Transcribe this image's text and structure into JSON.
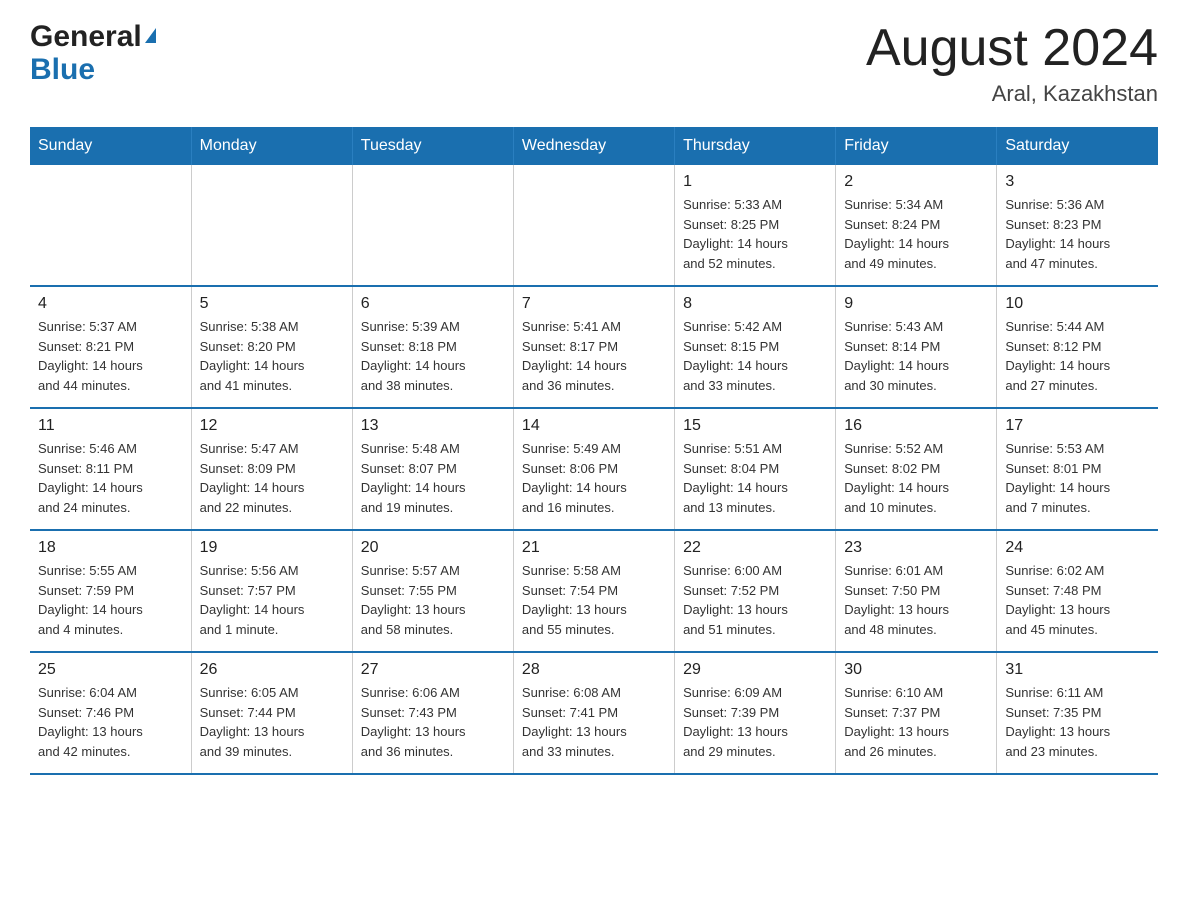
{
  "header": {
    "logo_general": "General",
    "logo_blue": "Blue",
    "month_title": "August 2024",
    "location": "Aral, Kazakhstan"
  },
  "weekdays": [
    "Sunday",
    "Monday",
    "Tuesday",
    "Wednesday",
    "Thursday",
    "Friday",
    "Saturday"
  ],
  "weeks": [
    [
      {
        "day": "",
        "info": ""
      },
      {
        "day": "",
        "info": ""
      },
      {
        "day": "",
        "info": ""
      },
      {
        "day": "",
        "info": ""
      },
      {
        "day": "1",
        "info": "Sunrise: 5:33 AM\nSunset: 8:25 PM\nDaylight: 14 hours\nand 52 minutes."
      },
      {
        "day": "2",
        "info": "Sunrise: 5:34 AM\nSunset: 8:24 PM\nDaylight: 14 hours\nand 49 minutes."
      },
      {
        "day": "3",
        "info": "Sunrise: 5:36 AM\nSunset: 8:23 PM\nDaylight: 14 hours\nand 47 minutes."
      }
    ],
    [
      {
        "day": "4",
        "info": "Sunrise: 5:37 AM\nSunset: 8:21 PM\nDaylight: 14 hours\nand 44 minutes."
      },
      {
        "day": "5",
        "info": "Sunrise: 5:38 AM\nSunset: 8:20 PM\nDaylight: 14 hours\nand 41 minutes."
      },
      {
        "day": "6",
        "info": "Sunrise: 5:39 AM\nSunset: 8:18 PM\nDaylight: 14 hours\nand 38 minutes."
      },
      {
        "day": "7",
        "info": "Sunrise: 5:41 AM\nSunset: 8:17 PM\nDaylight: 14 hours\nand 36 minutes."
      },
      {
        "day": "8",
        "info": "Sunrise: 5:42 AM\nSunset: 8:15 PM\nDaylight: 14 hours\nand 33 minutes."
      },
      {
        "day": "9",
        "info": "Sunrise: 5:43 AM\nSunset: 8:14 PM\nDaylight: 14 hours\nand 30 minutes."
      },
      {
        "day": "10",
        "info": "Sunrise: 5:44 AM\nSunset: 8:12 PM\nDaylight: 14 hours\nand 27 minutes."
      }
    ],
    [
      {
        "day": "11",
        "info": "Sunrise: 5:46 AM\nSunset: 8:11 PM\nDaylight: 14 hours\nand 24 minutes."
      },
      {
        "day": "12",
        "info": "Sunrise: 5:47 AM\nSunset: 8:09 PM\nDaylight: 14 hours\nand 22 minutes."
      },
      {
        "day": "13",
        "info": "Sunrise: 5:48 AM\nSunset: 8:07 PM\nDaylight: 14 hours\nand 19 minutes."
      },
      {
        "day": "14",
        "info": "Sunrise: 5:49 AM\nSunset: 8:06 PM\nDaylight: 14 hours\nand 16 minutes."
      },
      {
        "day": "15",
        "info": "Sunrise: 5:51 AM\nSunset: 8:04 PM\nDaylight: 14 hours\nand 13 minutes."
      },
      {
        "day": "16",
        "info": "Sunrise: 5:52 AM\nSunset: 8:02 PM\nDaylight: 14 hours\nand 10 minutes."
      },
      {
        "day": "17",
        "info": "Sunrise: 5:53 AM\nSunset: 8:01 PM\nDaylight: 14 hours\nand 7 minutes."
      }
    ],
    [
      {
        "day": "18",
        "info": "Sunrise: 5:55 AM\nSunset: 7:59 PM\nDaylight: 14 hours\nand 4 minutes."
      },
      {
        "day": "19",
        "info": "Sunrise: 5:56 AM\nSunset: 7:57 PM\nDaylight: 14 hours\nand 1 minute."
      },
      {
        "day": "20",
        "info": "Sunrise: 5:57 AM\nSunset: 7:55 PM\nDaylight: 13 hours\nand 58 minutes."
      },
      {
        "day": "21",
        "info": "Sunrise: 5:58 AM\nSunset: 7:54 PM\nDaylight: 13 hours\nand 55 minutes."
      },
      {
        "day": "22",
        "info": "Sunrise: 6:00 AM\nSunset: 7:52 PM\nDaylight: 13 hours\nand 51 minutes."
      },
      {
        "day": "23",
        "info": "Sunrise: 6:01 AM\nSunset: 7:50 PM\nDaylight: 13 hours\nand 48 minutes."
      },
      {
        "day": "24",
        "info": "Sunrise: 6:02 AM\nSunset: 7:48 PM\nDaylight: 13 hours\nand 45 minutes."
      }
    ],
    [
      {
        "day": "25",
        "info": "Sunrise: 6:04 AM\nSunset: 7:46 PM\nDaylight: 13 hours\nand 42 minutes."
      },
      {
        "day": "26",
        "info": "Sunrise: 6:05 AM\nSunset: 7:44 PM\nDaylight: 13 hours\nand 39 minutes."
      },
      {
        "day": "27",
        "info": "Sunrise: 6:06 AM\nSunset: 7:43 PM\nDaylight: 13 hours\nand 36 minutes."
      },
      {
        "day": "28",
        "info": "Sunrise: 6:08 AM\nSunset: 7:41 PM\nDaylight: 13 hours\nand 33 minutes."
      },
      {
        "day": "29",
        "info": "Sunrise: 6:09 AM\nSunset: 7:39 PM\nDaylight: 13 hours\nand 29 minutes."
      },
      {
        "day": "30",
        "info": "Sunrise: 6:10 AM\nSunset: 7:37 PM\nDaylight: 13 hours\nand 26 minutes."
      },
      {
        "day": "31",
        "info": "Sunrise: 6:11 AM\nSunset: 7:35 PM\nDaylight: 13 hours\nand 23 minutes."
      }
    ]
  ]
}
